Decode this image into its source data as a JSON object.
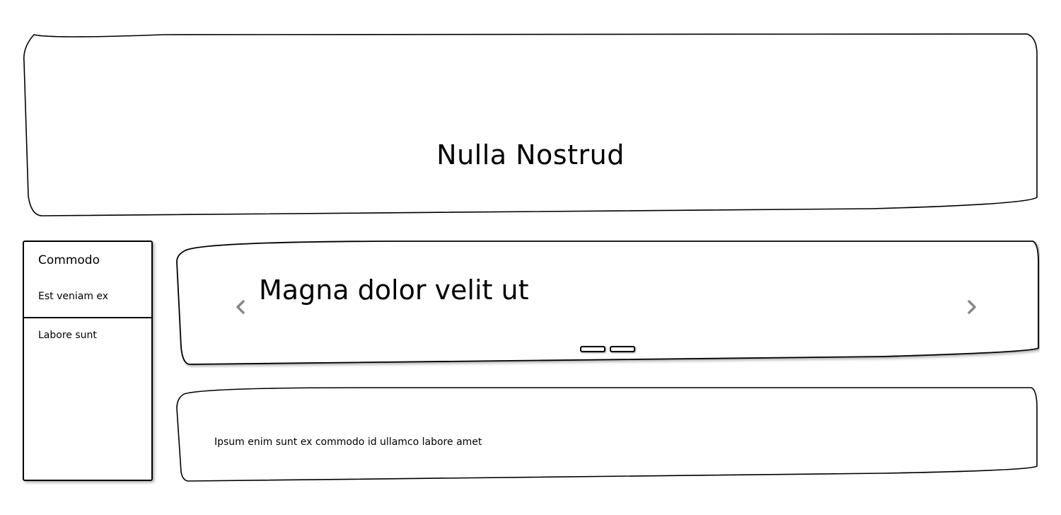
{
  "hero": {
    "title": "Nulla Nostrud"
  },
  "sidebar": {
    "header": "Commodo",
    "items": [
      {
        "label": "Est veniam ex"
      },
      {
        "label": "Labore sunt"
      }
    ]
  },
  "carousel": {
    "slide_title": "Magna dolor velit ut",
    "prev_icon": "chevron-left-icon",
    "next_icon": "chevron-right-icon",
    "indicator_count": 2,
    "arrow_color": "#888888"
  },
  "content": {
    "text": "Ipsum enim sunt ex commodo id ullamco labore amet"
  }
}
